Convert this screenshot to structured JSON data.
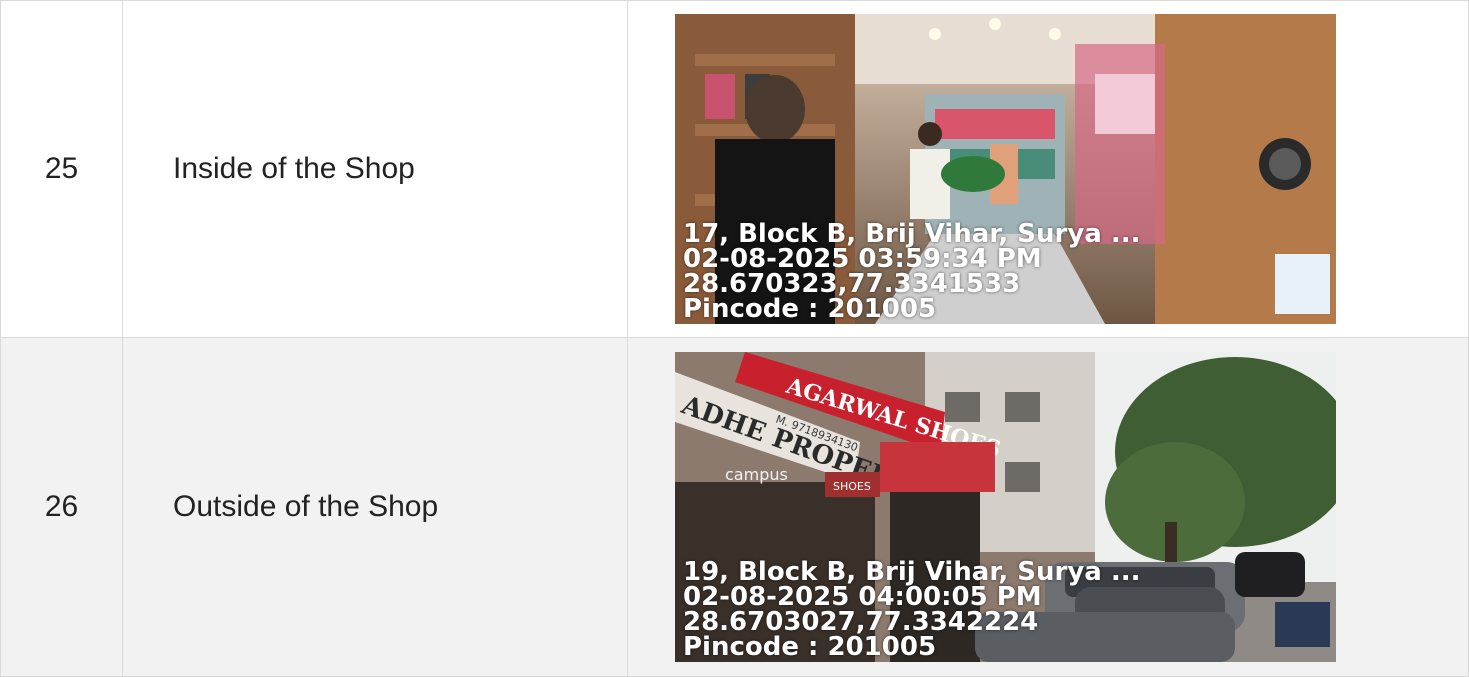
{
  "rows": [
    {
      "number": "25",
      "description": "Inside of the Shop",
      "overlay": {
        "address": "17, Block B, Brij Vihar, Surya ...",
        "datetime": "02-08-2025 03:59:34 PM",
        "coords": "28.670323,77.3341533",
        "pincode": "Pincode : 201005"
      }
    },
    {
      "number": "26",
      "description": "Outside of the Shop",
      "overlay": {
        "address": "19, Block B, Brij Vihar, Surya ...",
        "datetime": "02-08-2025 04:00:05 PM",
        "coords": "28.6703027,77.3342224",
        "pincode": "Pincode : 201005"
      },
      "signage": {
        "shoe_store": "AGARWAL SHOES",
        "properties": "ADHE PROPERTIES",
        "phone": "M. 9718934130",
        "brand": "campus",
        "shoes_sign": "SHOES"
      }
    }
  ]
}
